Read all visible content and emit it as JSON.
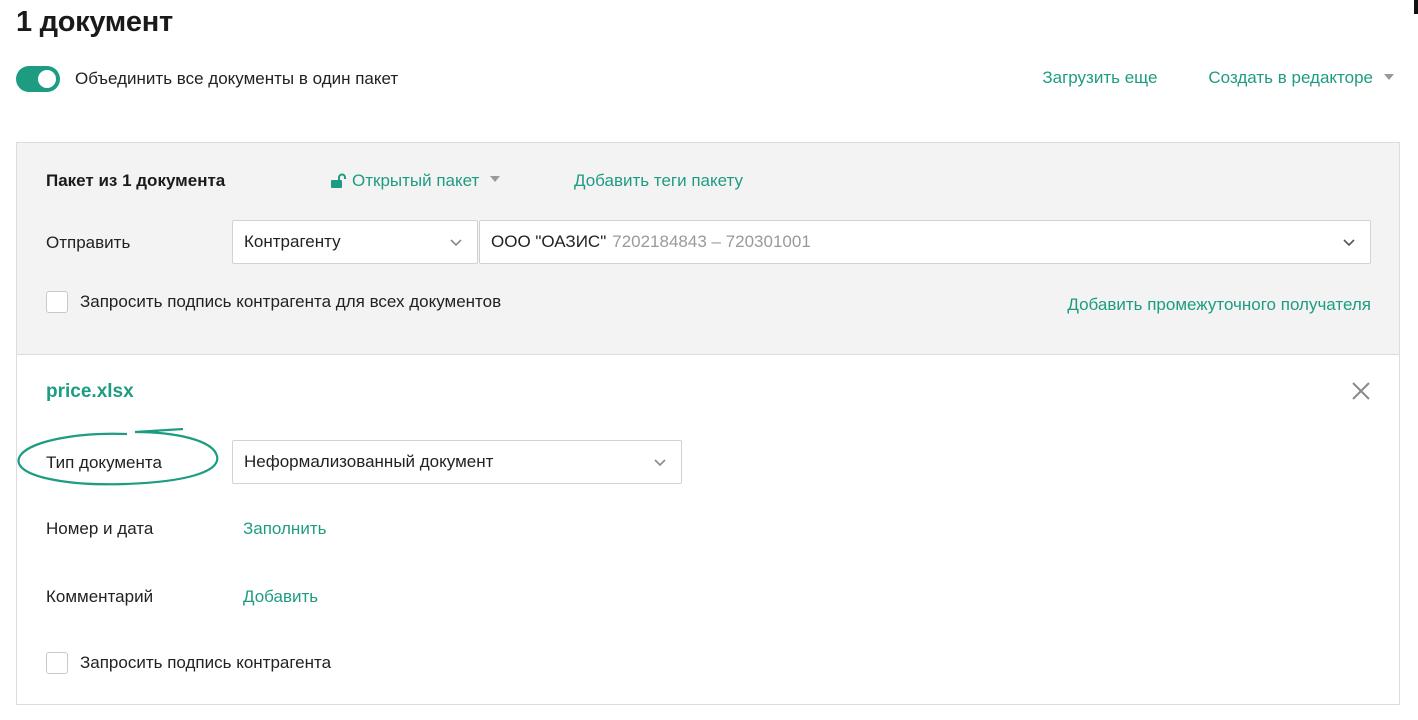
{
  "page": {
    "title": "1 документ"
  },
  "merge": {
    "label": "Объединить все документы в один пакет",
    "enabled": true
  },
  "top_actions": {
    "upload_more": "Загрузить еще",
    "create_in_editor": "Создать в редакторе"
  },
  "package": {
    "title": "Пакет из 1 документа",
    "access": "Открытый пакет",
    "add_tags": "Добавить теги пакету",
    "send_label": "Отправить",
    "recipient_type": "Контрагенту",
    "counterparty": {
      "name": "ООО \"ОАЗИС\"",
      "ids": "7202184843 – 720301001"
    },
    "request_sign_all": "Запросить подпись контрагента для всех документов",
    "add_intermediate": "Добавить промежуточного получателя"
  },
  "document": {
    "file_name": "price.xlsx",
    "type_label": "Тип документа",
    "type_value": "Неформализованный документ",
    "number_date_label": "Номер и дата",
    "fill_link": "Заполнить",
    "comment_label": "Комментарий",
    "comment_link": "Добавить",
    "request_sign": "Запросить подпись контрагента"
  },
  "colors": {
    "accent": "#1e9c82",
    "muted_text": "#9a9a9a",
    "panel_bg": "#f3f3f3",
    "border": "#dcdcdc"
  },
  "icons": {
    "lock": "lock-open-icon",
    "chevron": "chevron-down-icon",
    "close": "close-icon",
    "caret": "caret-down-icon"
  }
}
